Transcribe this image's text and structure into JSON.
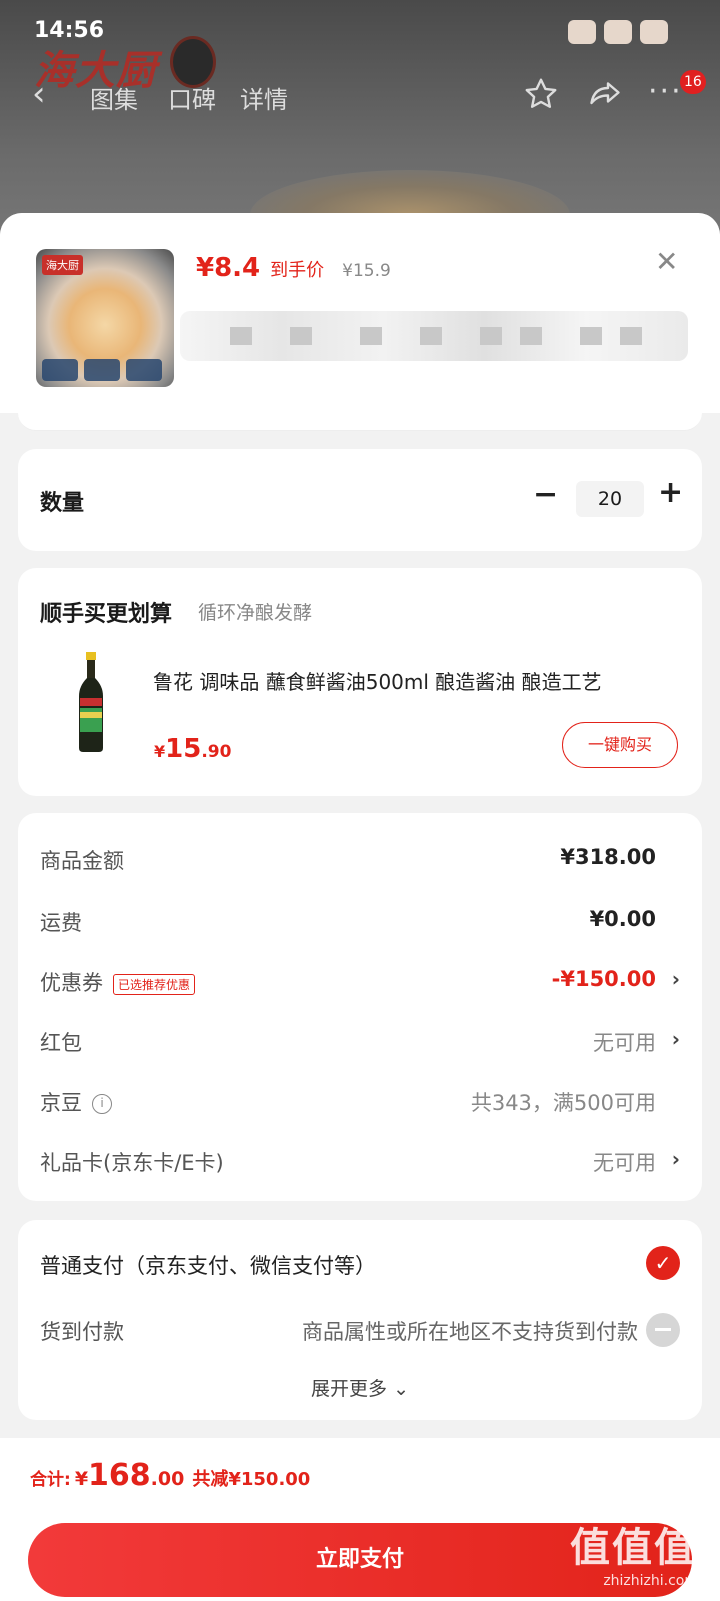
{
  "status_bar": {
    "time": "14:56"
  },
  "background": {
    "brand": "海大厨",
    "tabs": [
      "图集",
      "口碑",
      "详情"
    ],
    "cart_badge": "16"
  },
  "product": {
    "price_symbol": "¥",
    "price": "8.4",
    "price_label": "到手价",
    "original_price": "¥15.9",
    "thumb_tag": "海大厨"
  },
  "quantity": {
    "label": "数量",
    "minus": "−",
    "value": "20",
    "plus": "+"
  },
  "addon": {
    "title": "顺手买更划算",
    "subtitle": "循环净酿发酵",
    "product_name": "鲁花 调味品 蘸食鲜酱油500ml 酿造酱油  酿造工艺",
    "price_yen": "¥",
    "price_int": "15",
    "price_dec": ".90",
    "buy_label": "一键购买"
  },
  "fees": {
    "goods_label": "商品金额",
    "goods_value": "¥318.00",
    "shipping_label": "运费",
    "shipping_value": "¥0.00",
    "coupon_label": "优惠券",
    "coupon_tag": "已选推荐优惠",
    "coupon_value": "-¥150.00",
    "redpack_label": "红包",
    "redpack_value": "无可用",
    "jingdou_label": "京豆",
    "jingdou_value": "共343，满500可用",
    "giftcard_label": "礼品卡(京东卡/E卡)",
    "giftcard_value": "无可用"
  },
  "payment": {
    "option1": "普通支付（京东支付、微信支付等）",
    "option2": "货到付款",
    "option2_note": "商品属性或所在地区不支持货到付款",
    "expand": "展开更多"
  },
  "footer": {
    "total_label": "合计:",
    "total_yen": "¥",
    "total_int": "168",
    "total_dec": ".00",
    "saved": "共减¥150.00",
    "pay_button": "立即支付"
  },
  "watermark": {
    "text": "值值值",
    "url": "zhizhizhi.com"
  },
  "colors": {
    "accent": "#e2231a"
  }
}
